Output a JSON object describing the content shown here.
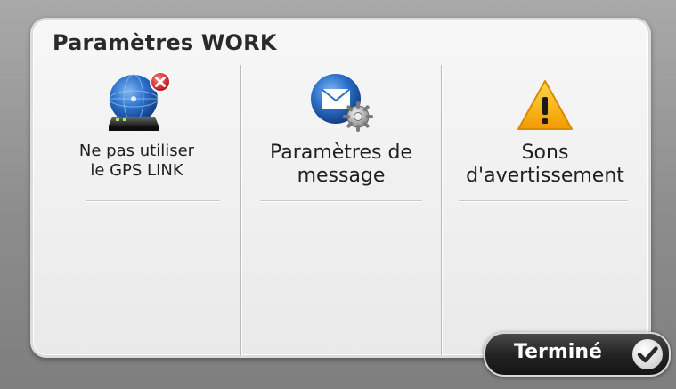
{
  "panel": {
    "title": "Paramètres WORK"
  },
  "items": [
    {
      "lines": [
        "Ne pas utiliser",
        "le GPS LINK"
      ],
      "icon": "gps-link-disconnect-icon"
    },
    {
      "lines": [
        "Paramètres de",
        "message"
      ],
      "icon": "message-settings-icon"
    },
    {
      "lines": [
        "Sons",
        "d'avertissement"
      ],
      "icon": "warning-icon"
    }
  ],
  "done_button": {
    "label": "Terminé",
    "icon": "checkmark-icon"
  },
  "colors": {
    "warning_yellow": "#f5b400",
    "globe_blue": "#2b6fc9",
    "error_red": "#d9262c",
    "button_dark": "#1c1c1c"
  }
}
